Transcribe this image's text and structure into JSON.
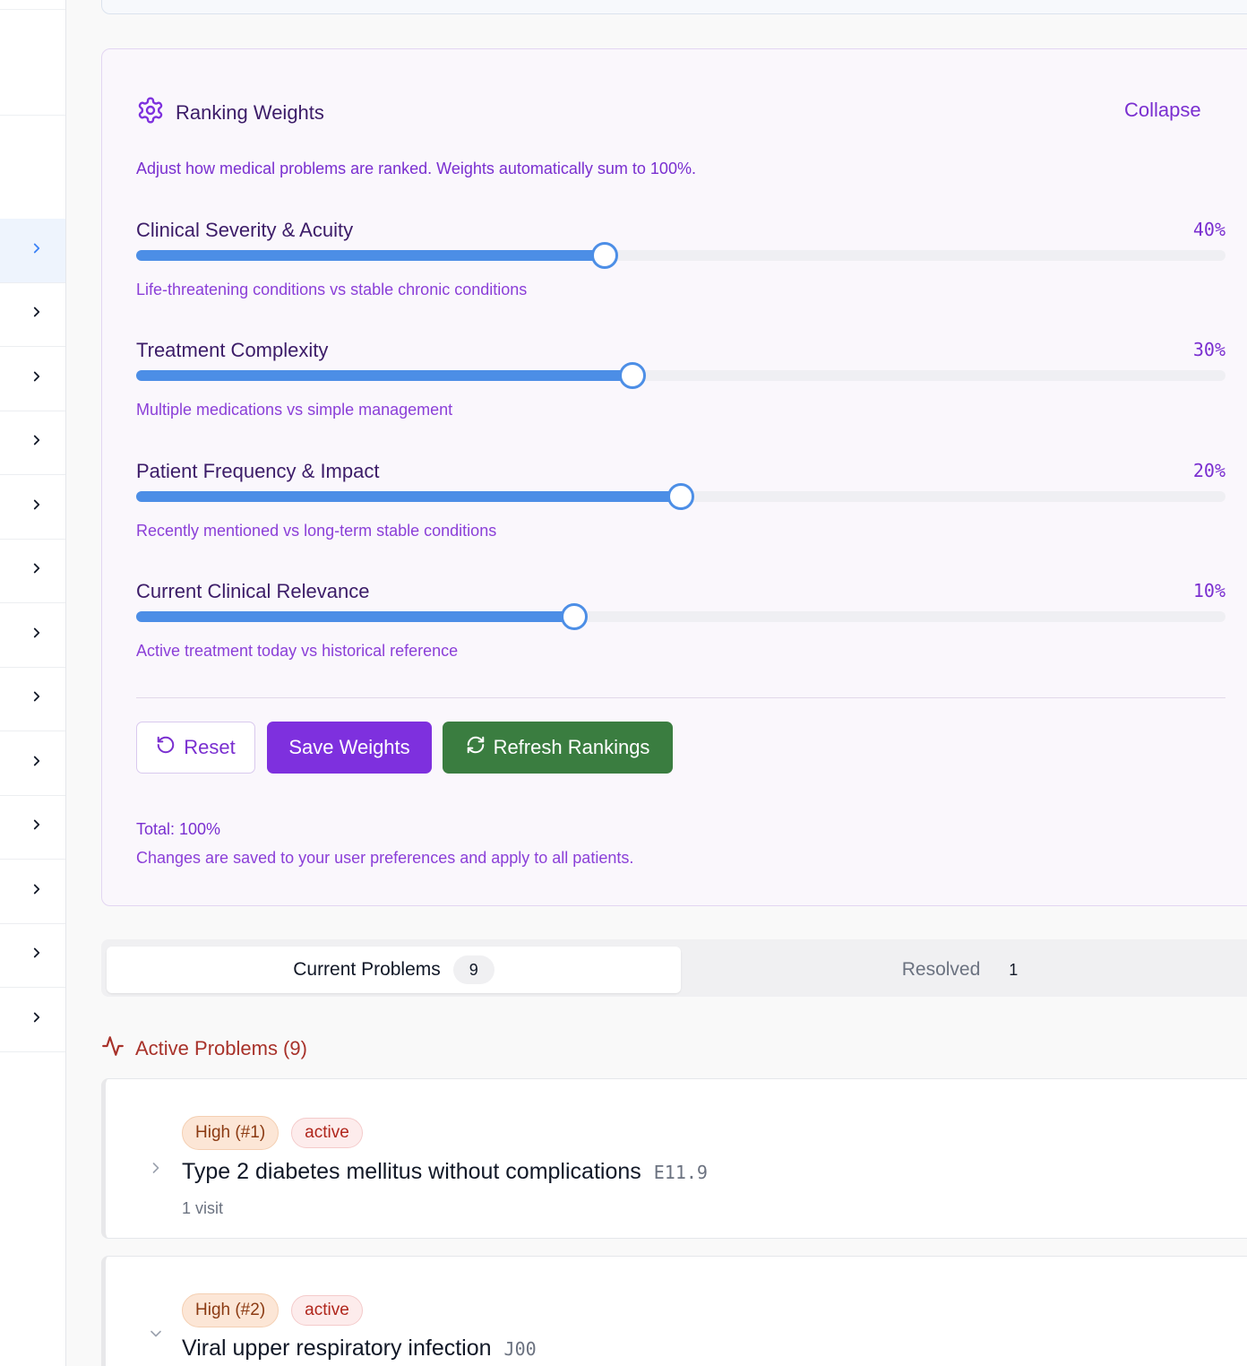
{
  "sidebar": {
    "row_count": 13,
    "active_index": 0,
    "icon": "chevron-right-icon"
  },
  "weights": {
    "title": "Ranking Weights",
    "icon": "gear-icon",
    "collapse_label": "Collapse",
    "description": "Adjust how medical problems are ranked. Weights automatically sum to 100%.",
    "sliders": [
      {
        "label": "Clinical Severity & Acuity",
        "value_text": "40%",
        "hint": "Life-threatening conditions vs stable chronic conditions",
        "level": 0.43
      },
      {
        "label": "Treatment Complexity",
        "value_text": "30%",
        "hint": "Multiple medications vs simple management",
        "level": 0.456
      },
      {
        "label": "Patient Frequency & Impact",
        "value_text": "20%",
        "hint": "Recently mentioned vs long-term stable conditions",
        "level": 0.5
      },
      {
        "label": "Current Clinical Relevance",
        "value_text": "10%",
        "hint": "Active treatment today vs historical reference",
        "level": 0.402
      }
    ],
    "buttons": {
      "reset": "Reset",
      "save": "Save Weights",
      "refresh": "Refresh Rankings"
    },
    "total": "Total: 100%",
    "note": "Changes are saved to your user preferences and apply to all patients."
  },
  "tabs": {
    "current": {
      "label": "Current Problems",
      "count": "9"
    },
    "resolved": {
      "label": "Resolved",
      "count": "1"
    }
  },
  "active_problems": {
    "title": "Active Problems (9)",
    "icon": "activity-icon",
    "items": [
      {
        "priority": "High (#1)",
        "status": "active",
        "title": "Type 2 diabetes mellitus without complications",
        "code": "E11.9",
        "visits": "1 visit",
        "expanded": false
      },
      {
        "priority": "High (#2)",
        "status": "active",
        "title": "Viral upper respiratory infection",
        "code": "J00",
        "expanded": true
      }
    ]
  },
  "colors": {
    "accent_purple": "#7e30de",
    "slider_blue": "#4c8ee6",
    "refresh_green": "#3a7d40",
    "problem_red": "#a8322a"
  }
}
